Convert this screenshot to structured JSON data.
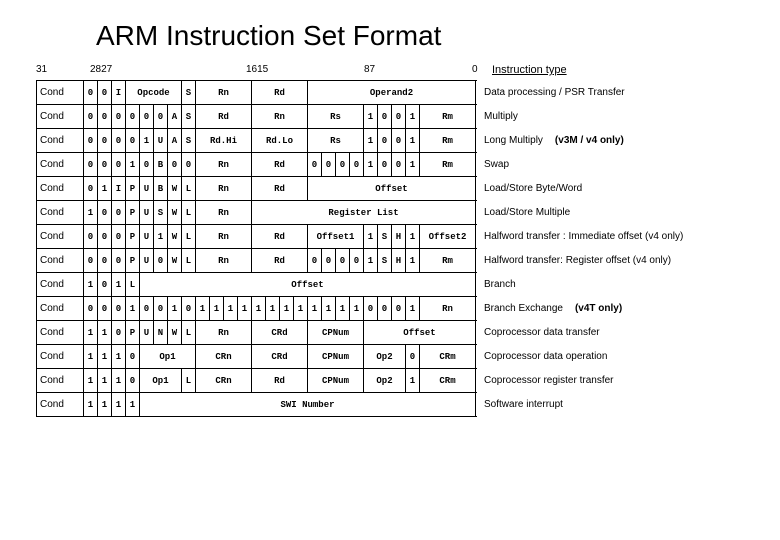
{
  "title": "ARM Instruction Set Format",
  "bit_labels": {
    "b31": "31",
    "b2827": "2827",
    "b1615": "1615",
    "b87": "87",
    "b0": "0"
  },
  "header_instruction": "Instruction type",
  "rows": [
    {
      "cond": "Cond",
      "cells": [
        {
          "t": "0",
          "span": 1
        },
        {
          "t": "0",
          "span": 1
        },
        {
          "t": "I",
          "span": 1
        },
        {
          "t": "Opcode",
          "span": 4
        },
        {
          "t": "S",
          "span": 1
        },
        {
          "t": "Rn",
          "span": 4
        },
        {
          "t": "Rd",
          "span": 4
        },
        {
          "t": "Operand2",
          "span": 12
        }
      ],
      "desc": "Data processing / PSR Transfer"
    },
    {
      "cond": "Cond",
      "cells": [
        {
          "t": "0",
          "span": 1
        },
        {
          "t": "0",
          "span": 1
        },
        {
          "t": "0",
          "span": 1
        },
        {
          "t": "0",
          "span": 1
        },
        {
          "t": "0",
          "span": 1
        },
        {
          "t": "0",
          "span": 1
        },
        {
          "t": "A",
          "span": 1
        },
        {
          "t": "S",
          "span": 1
        },
        {
          "t": "Rd",
          "span": 4
        },
        {
          "t": "Rn",
          "span": 4
        },
        {
          "t": "Rs",
          "span": 4
        },
        {
          "t": "1",
          "span": 1
        },
        {
          "t": "0",
          "span": 1
        },
        {
          "t": "0",
          "span": 1
        },
        {
          "t": "1",
          "span": 1
        },
        {
          "t": "Rm",
          "span": 4
        }
      ],
      "desc": "Multiply"
    },
    {
      "cond": "Cond",
      "cells": [
        {
          "t": "0",
          "span": 1
        },
        {
          "t": "0",
          "span": 1
        },
        {
          "t": "0",
          "span": 1
        },
        {
          "t": "0",
          "span": 1
        },
        {
          "t": "1",
          "span": 1
        },
        {
          "t": "U",
          "span": 1
        },
        {
          "t": "A",
          "span": 1
        },
        {
          "t": "S",
          "span": 1
        },
        {
          "t": "Rd.Hi",
          "span": 4
        },
        {
          "t": "Rd.Lo",
          "span": 4
        },
        {
          "t": "Rs",
          "span": 4
        },
        {
          "t": "1",
          "span": 1
        },
        {
          "t": "0",
          "span": 1
        },
        {
          "t": "0",
          "span": 1
        },
        {
          "t": "1",
          "span": 1
        },
        {
          "t": "Rm",
          "span": 4
        }
      ],
      "desc": "Long Multiply",
      "suffix": "(v3M / v4 only)"
    },
    {
      "cond": "Cond",
      "cells": [
        {
          "t": "0",
          "span": 1
        },
        {
          "t": "0",
          "span": 1
        },
        {
          "t": "0",
          "span": 1
        },
        {
          "t": "1",
          "span": 1
        },
        {
          "t": "0",
          "span": 1
        },
        {
          "t": "B",
          "span": 1
        },
        {
          "t": "0",
          "span": 1
        },
        {
          "t": "0",
          "span": 1
        },
        {
          "t": "Rn",
          "span": 4
        },
        {
          "t": "Rd",
          "span": 4
        },
        {
          "t": "0",
          "span": 1
        },
        {
          "t": "0",
          "span": 1
        },
        {
          "t": "0",
          "span": 1
        },
        {
          "t": "0",
          "span": 1
        },
        {
          "t": "1",
          "span": 1
        },
        {
          "t": "0",
          "span": 1
        },
        {
          "t": "0",
          "span": 1
        },
        {
          "t": "1",
          "span": 1
        },
        {
          "t": "Rm",
          "span": 4
        }
      ],
      "desc": "Swap"
    },
    {
      "cond": "Cond",
      "cells": [
        {
          "t": "0",
          "span": 1
        },
        {
          "t": "1",
          "span": 1
        },
        {
          "t": "I",
          "span": 1
        },
        {
          "t": "P",
          "span": 1
        },
        {
          "t": "U",
          "span": 1
        },
        {
          "t": "B",
          "span": 1
        },
        {
          "t": "W",
          "span": 1
        },
        {
          "t": "L",
          "span": 1
        },
        {
          "t": "Rn",
          "span": 4
        },
        {
          "t": "Rd",
          "span": 4
        },
        {
          "t": "Offset",
          "span": 12
        }
      ],
      "desc": "Load/Store Byte/Word"
    },
    {
      "cond": "Cond",
      "cells": [
        {
          "t": "1",
          "span": 1
        },
        {
          "t": "0",
          "span": 1
        },
        {
          "t": "0",
          "span": 1
        },
        {
          "t": "P",
          "span": 1
        },
        {
          "t": "U",
          "span": 1
        },
        {
          "t": "S",
          "span": 1
        },
        {
          "t": "W",
          "span": 1
        },
        {
          "t": "L",
          "span": 1
        },
        {
          "t": "Rn",
          "span": 4
        },
        {
          "t": "Register List",
          "span": 16
        }
      ],
      "desc": "Load/Store Multiple"
    },
    {
      "cond": "Cond",
      "cells": [
        {
          "t": "0",
          "span": 1
        },
        {
          "t": "0",
          "span": 1
        },
        {
          "t": "0",
          "span": 1
        },
        {
          "t": "P",
          "span": 1
        },
        {
          "t": "U",
          "span": 1
        },
        {
          "t": "1",
          "span": 1
        },
        {
          "t": "W",
          "span": 1
        },
        {
          "t": "L",
          "span": 1
        },
        {
          "t": "Rn",
          "span": 4
        },
        {
          "t": "Rd",
          "span": 4
        },
        {
          "t": "Offset1",
          "span": 4
        },
        {
          "t": "1",
          "span": 1
        },
        {
          "t": "S",
          "span": 1
        },
        {
          "t": "H",
          "span": 1
        },
        {
          "t": "1",
          "span": 1
        },
        {
          "t": "Offset2",
          "span": 4
        }
      ],
      "desc": "Halfword transfer : Immediate offset (v4 only)",
      "small": true
    },
    {
      "cond": "Cond",
      "cells": [
        {
          "t": "0",
          "span": 1
        },
        {
          "t": "0",
          "span": 1
        },
        {
          "t": "0",
          "span": 1
        },
        {
          "t": "P",
          "span": 1
        },
        {
          "t": "U",
          "span": 1
        },
        {
          "t": "0",
          "span": 1
        },
        {
          "t": "W",
          "span": 1
        },
        {
          "t": "L",
          "span": 1
        },
        {
          "t": "Rn",
          "span": 4
        },
        {
          "t": "Rd",
          "span": 4
        },
        {
          "t": "0",
          "span": 1
        },
        {
          "t": "0",
          "span": 1
        },
        {
          "t": "0",
          "span": 1
        },
        {
          "t": "0",
          "span": 1
        },
        {
          "t": "1",
          "span": 1
        },
        {
          "t": "S",
          "span": 1
        },
        {
          "t": "H",
          "span": 1
        },
        {
          "t": "1",
          "span": 1
        },
        {
          "t": "Rm",
          "span": 4
        }
      ],
      "desc": "Halfword transfer: Register offset (v4 only)",
      "small": true
    },
    {
      "cond": "Cond",
      "cells": [
        {
          "t": "1",
          "span": 1
        },
        {
          "t": "0",
          "span": 1
        },
        {
          "t": "1",
          "span": 1
        },
        {
          "t": "L",
          "span": 1
        },
        {
          "t": "Offset",
          "span": 24
        }
      ],
      "desc": "Branch"
    },
    {
      "cond": "Cond",
      "cells": [
        {
          "t": "0",
          "span": 1
        },
        {
          "t": "0",
          "span": 1
        },
        {
          "t": "0",
          "span": 1
        },
        {
          "t": "1",
          "span": 1
        },
        {
          "t": "0",
          "span": 1
        },
        {
          "t": "0",
          "span": 1
        },
        {
          "t": "1",
          "span": 1
        },
        {
          "t": "0",
          "span": 1
        },
        {
          "t": "1",
          "span": 1
        },
        {
          "t": "1",
          "span": 1
        },
        {
          "t": "1",
          "span": 1
        },
        {
          "t": "1",
          "span": 1
        },
        {
          "t": "1",
          "span": 1
        },
        {
          "t": "1",
          "span": 1
        },
        {
          "t": "1",
          "span": 1
        },
        {
          "t": "1",
          "span": 1
        },
        {
          "t": "1",
          "span": 1
        },
        {
          "t": "1",
          "span": 1
        },
        {
          "t": "1",
          "span": 1
        },
        {
          "t": "1",
          "span": 1
        },
        {
          "t": "0",
          "span": 1
        },
        {
          "t": "0",
          "span": 1
        },
        {
          "t": "0",
          "span": 1
        },
        {
          "t": "1",
          "span": 1
        },
        {
          "t": "Rn",
          "span": 4
        }
      ],
      "desc": "Branch Exchange",
      "suffix": "(v4T only)"
    },
    {
      "cond": "Cond",
      "cells": [
        {
          "t": "1",
          "span": 1
        },
        {
          "t": "1",
          "span": 1
        },
        {
          "t": "0",
          "span": 1
        },
        {
          "t": "P",
          "span": 1
        },
        {
          "t": "U",
          "span": 1
        },
        {
          "t": "N",
          "span": 1
        },
        {
          "t": "W",
          "span": 1
        },
        {
          "t": "L",
          "span": 1
        },
        {
          "t": "Rn",
          "span": 4
        },
        {
          "t": "CRd",
          "span": 4
        },
        {
          "t": "CPNum",
          "span": 4
        },
        {
          "t": "Offset",
          "span": 8
        }
      ],
      "desc": "Coprocessor data transfer"
    },
    {
      "cond": "Cond",
      "cells": [
        {
          "t": "1",
          "span": 1
        },
        {
          "t": "1",
          "span": 1
        },
        {
          "t": "1",
          "span": 1
        },
        {
          "t": "0",
          "span": 1
        },
        {
          "t": "Op1",
          "span": 4
        },
        {
          "t": "CRn",
          "span": 4
        },
        {
          "t": "CRd",
          "span": 4
        },
        {
          "t": "CPNum",
          "span": 4
        },
        {
          "t": "Op2",
          "span": 3
        },
        {
          "t": "0",
          "span": 1
        },
        {
          "t": "CRm",
          "span": 4
        }
      ],
      "desc": "Coprocessor data operation"
    },
    {
      "cond": "Cond",
      "cells": [
        {
          "t": "1",
          "span": 1
        },
        {
          "t": "1",
          "span": 1
        },
        {
          "t": "1",
          "span": 1
        },
        {
          "t": "0",
          "span": 1
        },
        {
          "t": "Op1",
          "span": 3
        },
        {
          "t": "L",
          "span": 1
        },
        {
          "t": "CRn",
          "span": 4
        },
        {
          "t": "Rd",
          "span": 4
        },
        {
          "t": "CPNum",
          "span": 4
        },
        {
          "t": "Op2",
          "span": 3
        },
        {
          "t": "1",
          "span": 1
        },
        {
          "t": "CRm",
          "span": 4
        }
      ],
      "desc": "Coprocessor register transfer"
    },
    {
      "cond": "Cond",
      "cells": [
        {
          "t": "1",
          "span": 1
        },
        {
          "t": "1",
          "span": 1
        },
        {
          "t": "1",
          "span": 1
        },
        {
          "t": "1",
          "span": 1
        },
        {
          "t": "SWI Number",
          "span": 24
        }
      ],
      "desc": "Software interrupt"
    }
  ]
}
